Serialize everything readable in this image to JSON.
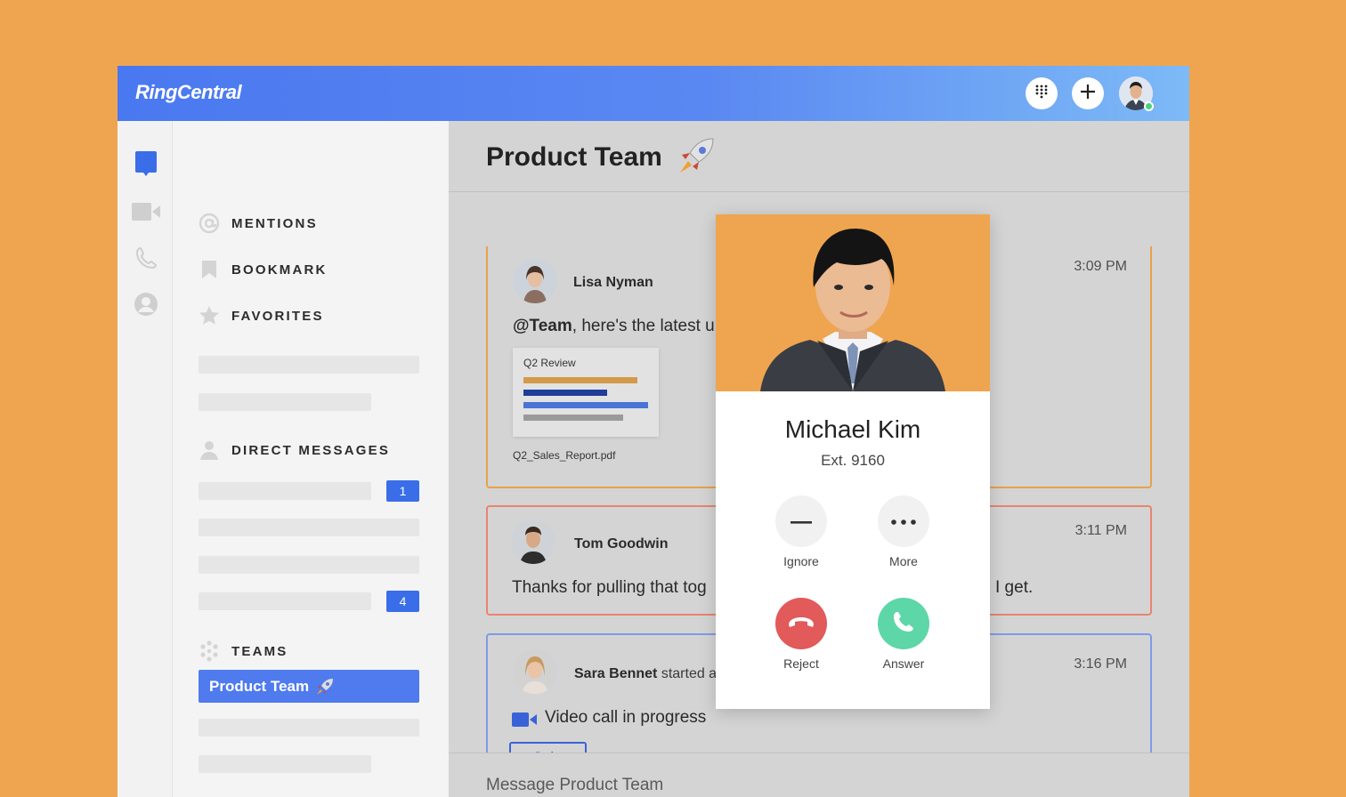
{
  "app": {
    "logo": "RingCentral"
  },
  "header": {
    "dialpad_icon": "dialpad-icon",
    "add_icon": "plus-icon",
    "avatar": "user-avatar"
  },
  "rail": {
    "items": [
      "chat-icon",
      "video-icon",
      "phone-icon",
      "contacts-icon"
    ]
  },
  "sidebar": {
    "mentions": "MENTIONS",
    "bookmark": "BOOKMARK",
    "favorites": "FAVORITES",
    "direct_messages": "DIRECT MESSAGES",
    "dm_badges": [
      "1",
      "4"
    ],
    "teams": "TEAMS",
    "active_team": "Product Team"
  },
  "main": {
    "title": "Product Team",
    "messages": [
      {
        "author": "Lisa Nyman",
        "time": "3:09 PM",
        "text_bold": "@Team",
        "text": ", here's the latest u",
        "attachment": {
          "title": "Q2 Review",
          "filename": "Q2_Sales_Report.pdf"
        }
      },
      {
        "author": "Tom Goodwin",
        "time": "3:11 PM",
        "text": "Thanks for pulling that tog",
        "text_tail": "I get."
      },
      {
        "author": "Sara Bennet",
        "author_suffix": " started a",
        "time": "3:16 PM",
        "text": "Video call in progress",
        "join_label": "Join"
      }
    ],
    "composer_placeholder": "Message Product Team"
  },
  "call": {
    "caller_name": "Michael Kim",
    "extension": "Ext. 9160",
    "actions": {
      "ignore": "Ignore",
      "more": "More",
      "reject": "Reject",
      "answer": "Answer"
    }
  },
  "colors": {
    "background": "#EFA54F",
    "header_start": "#4A78F0",
    "header_end": "#7DBAF6",
    "accent": "#3A6EE8",
    "reject": "#E25A5A",
    "answer": "#5DD6A8",
    "card_orange": "#E7A24A",
    "card_red": "#E88470",
    "card_blue": "#7F9BE8"
  }
}
